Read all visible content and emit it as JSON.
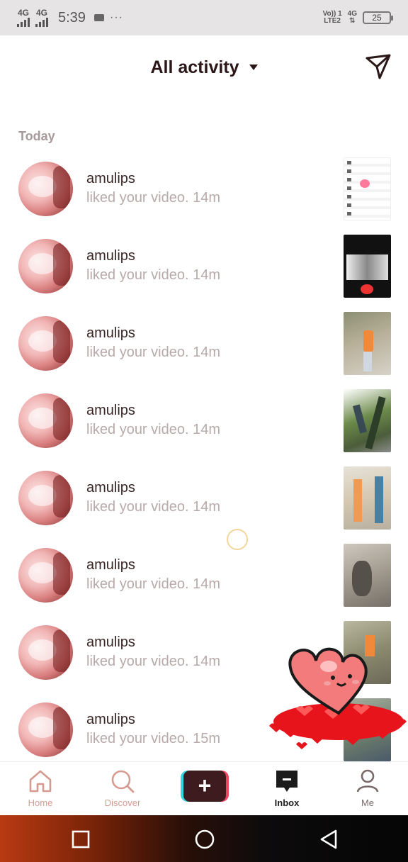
{
  "status_bar": {
    "signal1": "4G",
    "signal2": "4G",
    "time": "5:39",
    "dots": "···",
    "volte_top": "Vo)) 1",
    "volte_bottom": "LTE2",
    "net": "4G",
    "battery": "25"
  },
  "header": {
    "title": "All activity",
    "send_icon": "send-icon"
  },
  "section": {
    "today_label": "Today"
  },
  "activities": [
    {
      "user": "amulips",
      "text": "liked your video. 14m"
    },
    {
      "user": "amulips",
      "text": "liked your video. 14m"
    },
    {
      "user": "amulips",
      "text": "liked your video. 14m"
    },
    {
      "user": "amulips",
      "text": "liked your video. 14m"
    },
    {
      "user": "amulips",
      "text": "liked your video. 14m"
    },
    {
      "user": "amulips",
      "text": "liked your video. 14m"
    },
    {
      "user": "amulips",
      "text": "liked your video. 14m"
    },
    {
      "user": "amulips",
      "text": "liked your video. 15m"
    }
  ],
  "bottom_nav": {
    "home": "Home",
    "discover": "Discover",
    "create": "+",
    "inbox": "Inbox",
    "me": "Me"
  },
  "colors": {
    "accent_inactive": "#d59b90",
    "active": "#1c1c1c",
    "create_left": "#30d5df",
    "create_right": "#f2435f"
  }
}
